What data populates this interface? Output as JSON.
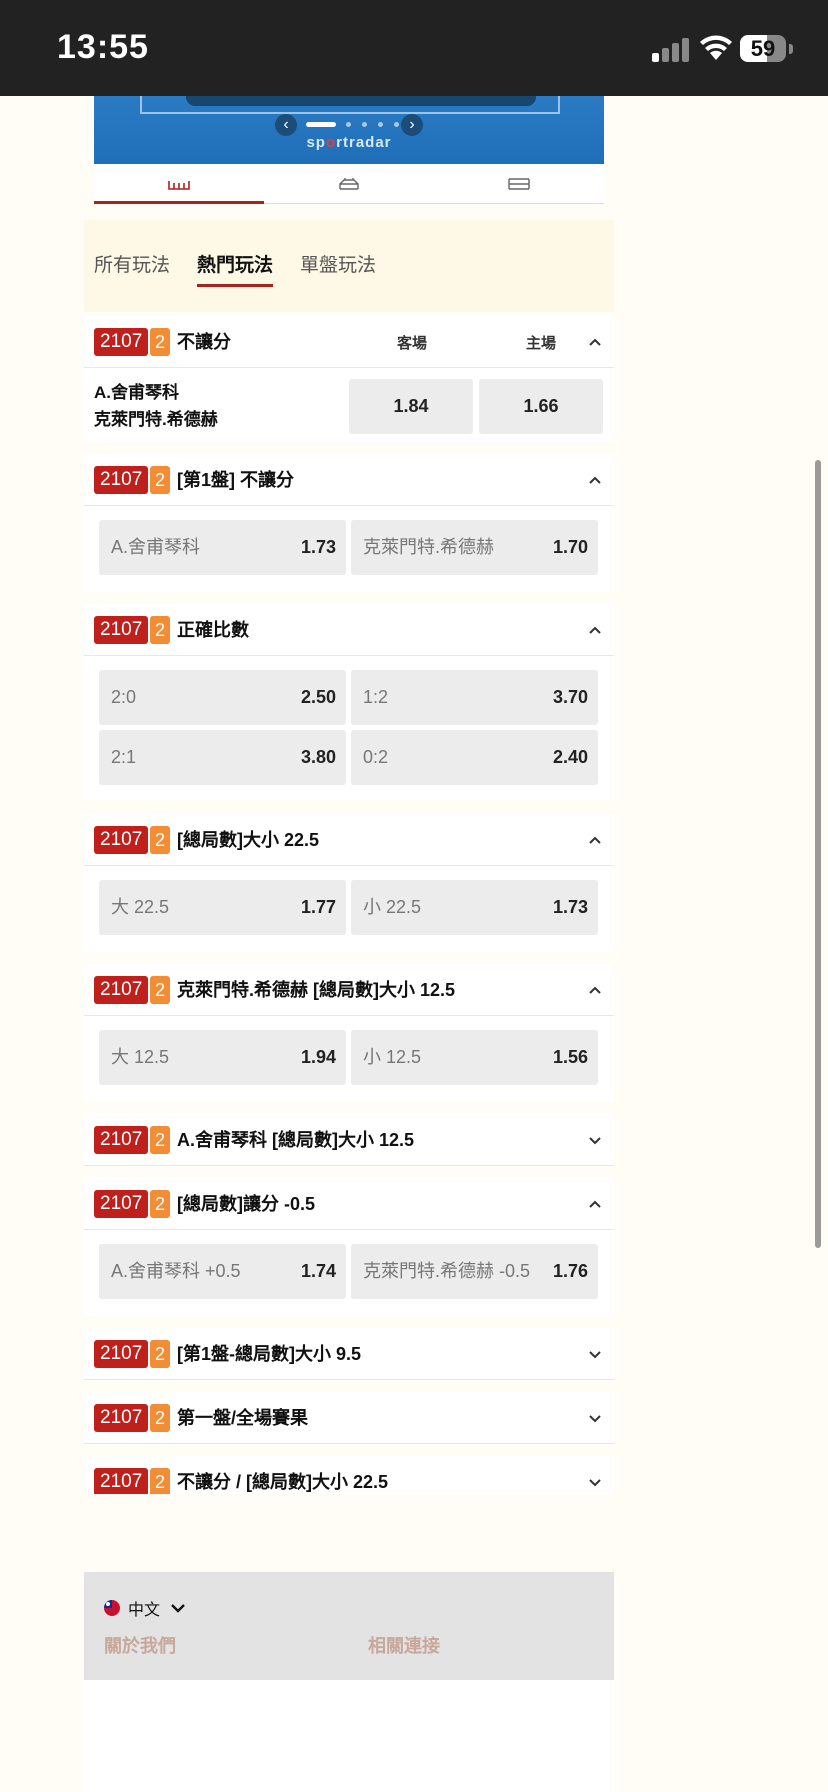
{
  "status": {
    "time": "13:55",
    "battery": "59",
    "battery_level": 0.59
  },
  "tracker": {
    "brand_pre": "sp",
    "brand_mid": "o",
    "brand_post": "rtradar",
    "slides": 6,
    "active_slide": 0
  },
  "view_tabs": [
    "field-view-icon",
    "stats-view-icon",
    "lineup-view-icon"
  ],
  "categories": [
    "所有玩法",
    "熱門玩法",
    "單盤玩法"
  ],
  "columns": {
    "away": "客場",
    "home": "主場"
  },
  "markets": [
    {
      "code": "2107",
      "num": "2",
      "title": "不讓分",
      "teams": [
        "A.舍甫琴科",
        "克萊門特.希德赫"
      ],
      "away_odd": "1.84",
      "home_odd": "1.66"
    },
    {
      "code": "2107",
      "num": "2",
      "title": "[第1盤] 不讓分",
      "options": [
        {
          "label": "A.舍甫琴科",
          "odd": "1.73"
        },
        {
          "label": "克萊門特.希德赫",
          "odd": "1.70"
        }
      ]
    },
    {
      "code": "2107",
      "num": "2",
      "title": "正確比數",
      "options": [
        {
          "label": "2:0",
          "odd": "2.50"
        },
        {
          "label": "1:2",
          "odd": "3.70"
        },
        {
          "label": "2:1",
          "odd": "3.80"
        },
        {
          "label": "0:2",
          "odd": "2.40"
        }
      ]
    },
    {
      "code": "2107",
      "num": "2",
      "title": "[總局數]大小 22.5",
      "options": [
        {
          "label": "大 22.5",
          "odd": "1.77"
        },
        {
          "label": "小 22.5",
          "odd": "1.73"
        }
      ]
    },
    {
      "code": "2107",
      "num": "2",
      "title": "克萊門特.希德赫 [總局數]大小 12.5",
      "options": [
        {
          "label": "大 12.5",
          "odd": "1.94"
        },
        {
          "label": "小 12.5",
          "odd": "1.56"
        }
      ]
    },
    {
      "code": "2107",
      "num": "2",
      "title": "A.舍甫琴科 [總局數]大小 12.5"
    },
    {
      "code": "2107",
      "num": "2",
      "title": "[總局數]讓分 -0.5",
      "options": [
        {
          "label": "A.舍甫琴科 +0.5",
          "odd": "1.74"
        },
        {
          "label": "克萊門特.希德赫 -0.5",
          "odd": "1.76"
        }
      ]
    },
    {
      "code": "2107",
      "num": "2",
      "title": "[第1盤-總局數]大小 9.5"
    },
    {
      "code": "2107",
      "num": "2",
      "title": "第一盤/全場賽果"
    },
    {
      "code": "2107",
      "num": "2",
      "title": "不讓分 / [總局數]大小 22.5"
    }
  ],
  "footer": {
    "language": "中文",
    "about": "關於我們",
    "links": "相關連接"
  },
  "colors": {
    "brand_red": "#c0201b",
    "badge_orange": "#f28d35",
    "tab_underline": "#a8231f",
    "status_bg": "#222222"
  }
}
